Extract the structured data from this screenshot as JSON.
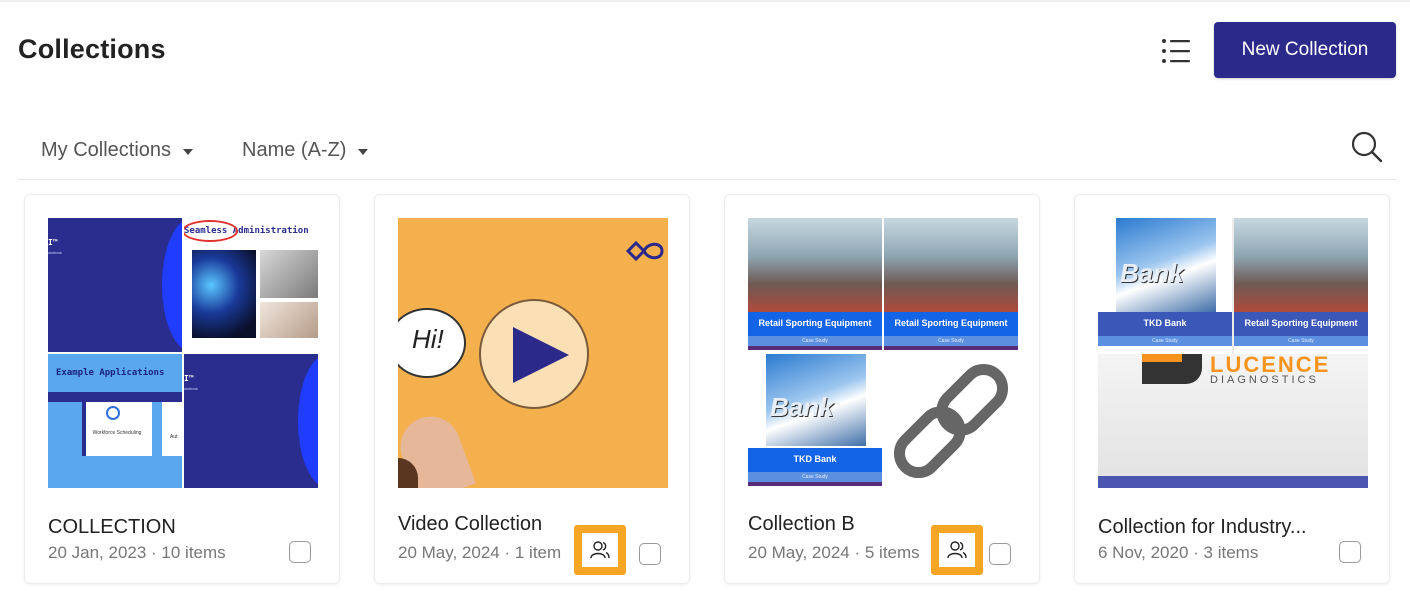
{
  "header": {
    "title": "Collections",
    "new_collection_label": "New Collection"
  },
  "filters": {
    "owner": "My Collections",
    "sort": "Name (A-Z)"
  },
  "icons": {
    "view_toggle": "list-icon",
    "search": "search-icon",
    "shared": "shared-users-icon",
    "link": "link-icon"
  },
  "colors": {
    "primary": "#2b2a8a",
    "shared_highlight": "#f6a623",
    "video_bg": "#f4b04d"
  },
  "collections": [
    {
      "name": "COLLECTION",
      "meta": "20 Jan, 2023 · 10 items",
      "shared": false,
      "thumb_text": {
        "logo_line1": "I™",
        "logo_line2": "olutions",
        "seamless": "Seamless Administration",
        "example": "Example Applications",
        "workforce": "Workforce Scheduling",
        "auto": "Aut",
        "logo2_line1": "I™",
        "logo2_line2": "olutions"
      }
    },
    {
      "name": "Video Collection",
      "meta": "20 May, 2024 · 1 item",
      "shared": true,
      "thumb_text": {
        "hi": "Hi!"
      }
    },
    {
      "name": "Collection B",
      "meta": "20 May, 2024 · 5 items",
      "shared": true,
      "thumb_text": {
        "retail1": "Retail Sporting Equipment",
        "retail2": "Retail Sporting Equipment",
        "case1": "Case Study",
        "case2": "Case Study",
        "bank": "Bank",
        "tkd": "TKD Bank",
        "case3": "Case Study"
      }
    },
    {
      "name": "Collection for Industry...",
      "meta": "6 Nov, 2020 · 3 items",
      "shared": false,
      "thumb_text": {
        "bank": "Bank",
        "tkd": "TKD Bank",
        "retail": "Retail Sporting Equipment",
        "case1": "Case Study",
        "case2": "Case Study",
        "lucence": "LUCENCE",
        "diagnostics": "DIAGNOSTICS"
      }
    }
  ]
}
